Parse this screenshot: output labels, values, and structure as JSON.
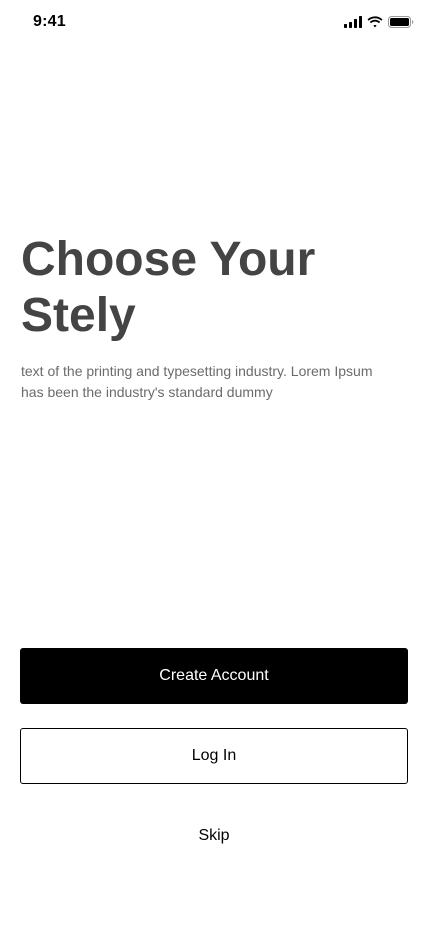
{
  "status_bar": {
    "time": "9:41",
    "icons": [
      "cellular-signal-icon",
      "wifi-icon",
      "battery-icon"
    ]
  },
  "onboarding": {
    "title_line_1": "Choose Your",
    "title_line_2": "Stely",
    "description": "text of the printing and typesetting industry. Lorem Ipsum has been the industry's standard dummy"
  },
  "actions": {
    "create_account_label": "Create Account",
    "log_in_label": "Log In",
    "skip_label": "Skip"
  },
  "colors": {
    "background": "#ffffff",
    "primary_button": "#000000",
    "title_text": "#444444",
    "description_text": "#6b6b6b"
  }
}
